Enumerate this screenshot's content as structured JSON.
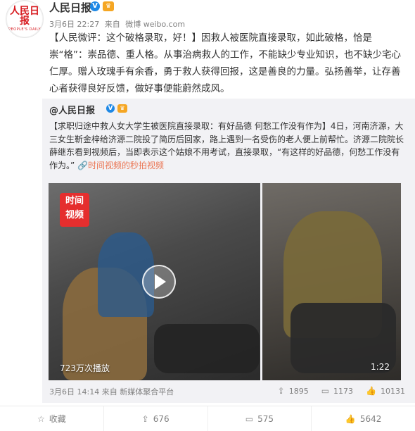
{
  "author": {
    "name": "人民日报",
    "avatar_text": "人民日报",
    "avatar_sub": "PEOPLE'S DAILY"
  },
  "meta": {
    "time": "3月6日 22:27",
    "source_prefix": "来自",
    "source": "微博 weibo.com"
  },
  "post": {
    "bracket": "【人民微评：这个破格录取，好！】",
    "text": "因救人被医院直接录取，如此破格，恰是崇“格”：崇品德、重人格。从事治病救人的工作，不能缺少专业知识，也不缺少宅心仁厚。赠人玫瑰手有余香，勇于救人获得回报，这是善良的力量。弘扬善举，让存善心者获得良好反馈，做好事便能蔚然成风。"
  },
  "repost": {
    "author": "@人民日报",
    "text": "【求职归途中救人女大学生被医院直接录取：有好品德 何愁工作没有作为】4日，河南济源，大三女生靳金梓给济源二院投了简历后回家，路上遇到一名受伤的老人便上前帮忙。济源二院院长薛继东看到视频后，当即表示这个姑娘不用考试，直接录取，“有这样的好品德，何愁工作没有作为。”",
    "link": "时间视频的秒拍视频",
    "video_tag": "时间\n视频",
    "video_views": "723万次播放",
    "duration": "1:22",
    "footer_time": "3月6日 14:14",
    "footer_source": "来自 新媒体聚合平台",
    "actions": {
      "share": "1895",
      "comment": "1173",
      "like": "10131"
    }
  },
  "bottom_bar": {
    "favorite": "收藏",
    "share": "676",
    "comment": "575",
    "like": "5642"
  }
}
